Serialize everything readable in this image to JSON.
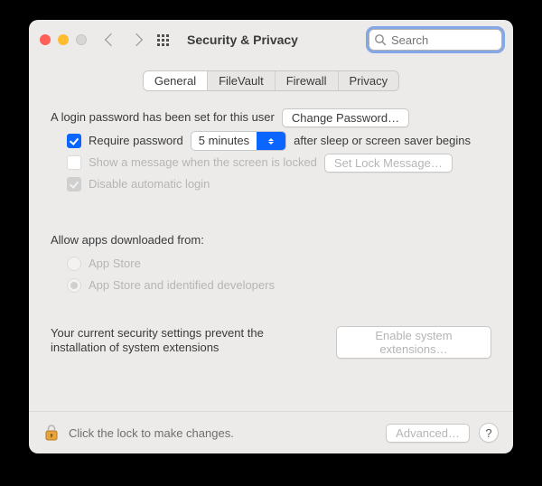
{
  "header": {
    "title": "Security & Privacy",
    "search_placeholder": "Search"
  },
  "tabs": [
    "General",
    "FileVault",
    "Firewall",
    "Privacy"
  ],
  "active_tab": "General",
  "general": {
    "login_password_text": "A login password has been set for this user",
    "change_password_btn": "Change Password…",
    "require_password_checked": true,
    "require_password_prefix": "Require password",
    "require_password_delay": "5 minutes",
    "require_password_suffix": "after sleep or screen saver begins",
    "show_message_checked": false,
    "show_message_label": "Show a message when the screen is locked",
    "set_lock_message_btn": "Set Lock Message…",
    "disable_auto_login_checked": true,
    "disable_auto_login_label": "Disable automatic login",
    "allow_apps_heading": "Allow apps downloaded from:",
    "allow_options": [
      "App Store",
      "App Store and identified developers"
    ],
    "allow_selected_index": 1,
    "system_extensions_text": "Your current security settings prevent the installation of system extensions",
    "enable_extensions_btn": "Enable system extensions…"
  },
  "footer": {
    "lock_text": "Click the lock to make changes.",
    "advanced_btn": "Advanced…",
    "help_glyph": "?"
  }
}
